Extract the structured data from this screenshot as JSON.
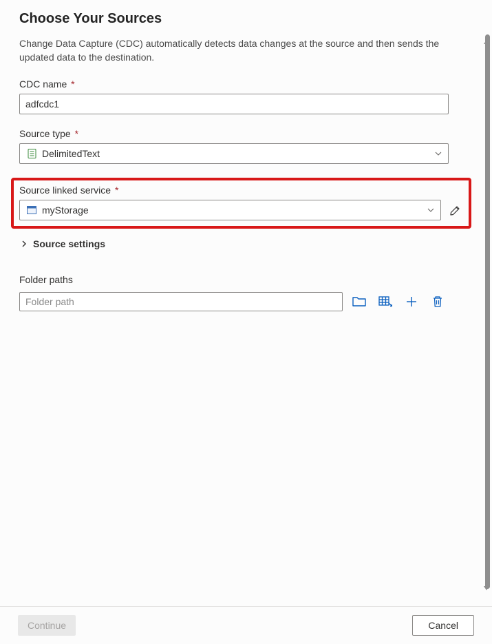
{
  "header": {
    "title": "Choose Your Sources",
    "description": "Change Data Capture (CDC) automatically detects data changes at the source and then sends the updated data to the destination."
  },
  "fields": {
    "cdc_name": {
      "label": "CDC name",
      "required": "*",
      "value": "adfcdc1"
    },
    "source_type": {
      "label": "Source type",
      "required": "*",
      "value": "DelimitedText"
    },
    "linked_service": {
      "label": "Source linked service",
      "required": "*",
      "value": "myStorage"
    },
    "source_settings": {
      "label": "Source settings"
    },
    "folder_paths": {
      "label": "Folder paths",
      "placeholder": "Folder path"
    }
  },
  "footer": {
    "continue_label": "Continue",
    "cancel_label": "Cancel"
  }
}
